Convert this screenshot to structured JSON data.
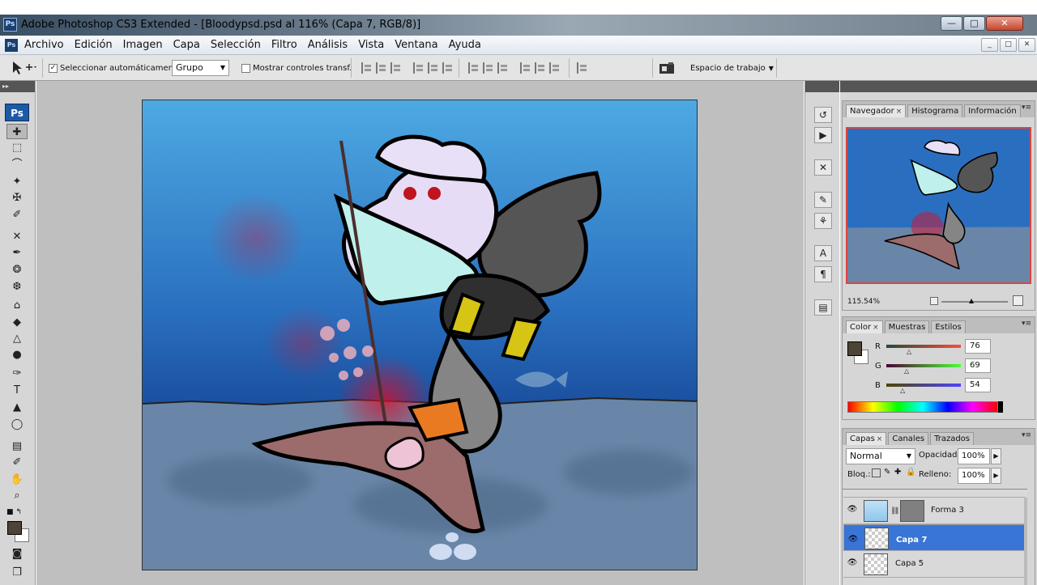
{
  "window": {
    "title": "Adobe Photoshop CS3 Extended - [Bloodypsd.psd al 116% (Capa 7, RGB/8)]",
    "min_label": "—",
    "max_label": "□",
    "close_label": "✕"
  },
  "app_icon": "Ps",
  "menu": {
    "items": [
      "Archivo",
      "Edición",
      "Imagen",
      "Capa",
      "Selección",
      "Filtro",
      "Análisis",
      "Vista",
      "Ventana",
      "Ayuda"
    ],
    "doc_min": "_",
    "doc_restore": "□",
    "doc_close": "✕"
  },
  "options": {
    "tool_icon": "move-tool-icon",
    "auto_select_label": "Seleccionar automáticamente:",
    "auto_select_checked": "✓",
    "auto_select_value": "Grupo",
    "show_transform_label": "Mostrar controles transf.",
    "workspace_label": "Espacio de trabajo",
    "workspace_arrow": "▼"
  },
  "toolbar": {
    "logo": "Ps",
    "grip": "▸▸",
    "tools": [
      "✚",
      "⬚",
      "⌒",
      "✦",
      "✠",
      "✐",
      "✕",
      "✒",
      "❂",
      "❆",
      "⌂",
      "◆",
      "△",
      "●",
      "✑",
      "T",
      "▲",
      "◯",
      "▤",
      "✐",
      "✋",
      "⌕",
      "■",
      "○",
      "□"
    ]
  },
  "navigator": {
    "tabs": [
      "Navegador",
      "Histograma",
      "Información"
    ],
    "zoom": "115.54%",
    "close_glyph": "×",
    "menu_glyph": "▾≡"
  },
  "color_panel": {
    "tabs": [
      "Color",
      "Muestras",
      "Estilos"
    ],
    "fg_color": "#4c4536",
    "channels": [
      {
        "label": "R",
        "value": "76",
        "track": "linear-gradient(90deg,#234a38,#ff4a38)"
      },
      {
        "label": "G",
        "value": "69",
        "track": "linear-gradient(90deg,#4c0036,#4cff36)"
      },
      {
        "label": "B",
        "value": "54",
        "track": "linear-gradient(90deg,#4c4500,#4c45ff)"
      }
    ]
  },
  "layers_panel": {
    "tabs": [
      "Capas",
      "Canales",
      "Trazados"
    ],
    "blend_mode": "Normal",
    "opacity_label": "Opacidad:",
    "opacity_value": "100%",
    "lock_label": "Bloq.:",
    "fill_label": "Relleno:",
    "fill_value": "100%",
    "layers": [
      {
        "name": "Forma 3",
        "selected": false
      },
      {
        "name": "Capa 7",
        "selected": true
      },
      {
        "name": "Capa 5",
        "selected": false
      }
    ]
  },
  "colors": {
    "selection": "#3875d7",
    "fg_swatch": "#4c4536"
  }
}
